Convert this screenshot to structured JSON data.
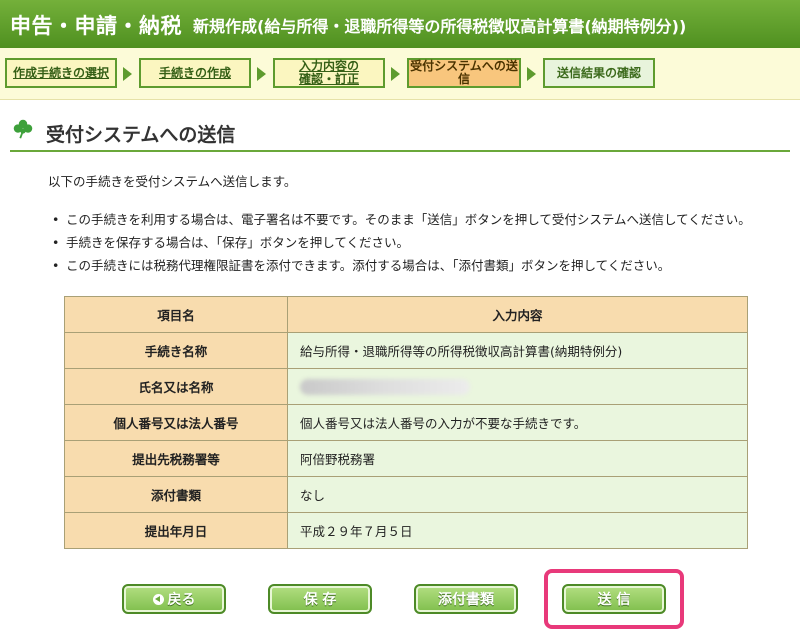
{
  "header": {
    "app_title": "申告・申請・納税",
    "doc_title": "新規作成(給与所得・退職所得等の所得税徴収高計算書(納期特例分))"
  },
  "steps": [
    {
      "label": "作成手続きの選択",
      "state": "done"
    },
    {
      "label": "手続きの作成",
      "state": "done"
    },
    {
      "label": "入力内容の\n確認・訂正",
      "state": "done"
    },
    {
      "label": "受付システムへの送\n信",
      "state": "current"
    },
    {
      "label": "送信結果の確認",
      "state": "pending"
    }
  ],
  "section": {
    "title": "受付システムへの送信",
    "icon": "clover-icon"
  },
  "intro": "以下の手続きを受付システムへ送信します。",
  "bullets": [
    "この手続きを利用する場合は、電子署名は不要です。そのまま「送信」ボタンを押して受付システムへ送信してください。",
    "手続きを保存する場合は、「保存」ボタンを押してください。",
    "この手続きには税務代理権限証書を添付できます。添付する場合は、「添付書類」ボタンを押してください。"
  ],
  "table": {
    "headers": [
      "項目名",
      "入力内容"
    ],
    "rows": [
      {
        "label": "手続き名称",
        "value": "給与所得・退職所得等の所得税徴収高計算書(納期特例分)"
      },
      {
        "label": "氏名又は名称",
        "value": ""
      },
      {
        "label": "個人番号又は法人番号",
        "value": "個人番号又は法人番号の入力が不要な手続きです。"
      },
      {
        "label": "提出先税務署等",
        "value": "阿倍野税務署"
      },
      {
        "label": "添付書類",
        "value": "なし"
      },
      {
        "label": "提出年月日",
        "value": "平成２９年７月５日"
      }
    ]
  },
  "buttons": {
    "back": "戻る",
    "save": "保 存",
    "attach": "添付書類",
    "send": "送 信"
  },
  "colors": {
    "header_green": "#5e9b2e",
    "current_step": "#f8c67d",
    "highlight": "#e8397a"
  }
}
